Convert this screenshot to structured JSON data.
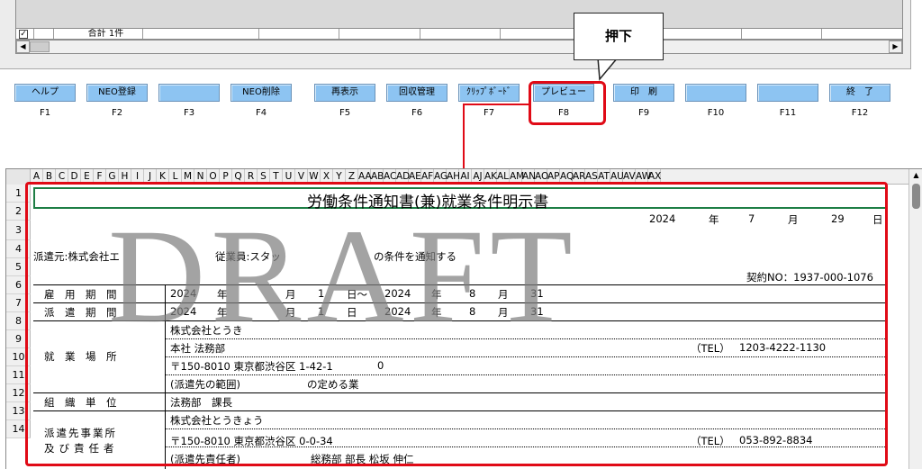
{
  "list": {
    "checkbox_mark": "✓",
    "total_label": "合計 1件",
    "scroll_left": "◀",
    "scroll_right": "▶"
  },
  "function_keys": [
    {
      "label": "ヘルプ",
      "key": "F1"
    },
    {
      "label": "NEO登録",
      "key": "F2"
    },
    {
      "label": "",
      "key": "F3"
    },
    {
      "label": "NEO削除",
      "key": "F4"
    },
    {
      "label": "再表示",
      "key": "F5"
    },
    {
      "label": "回収管理",
      "key": "F6"
    },
    {
      "label": "ｸﾘｯﾌﾟﾎﾞｰﾄﾞ",
      "key": "F7"
    },
    {
      "label": "プレビュー",
      "key": "F8"
    },
    {
      "label": "印　刷",
      "key": "F9"
    },
    {
      "label": "",
      "key": "F10"
    },
    {
      "label": "",
      "key": "F11"
    },
    {
      "label": "終　了",
      "key": "F12"
    }
  ],
  "callout": {
    "text": "押下"
  },
  "colors": {
    "highlight": "#e00a16",
    "button": "#8dc4f2",
    "selection": "#1e7e45"
  },
  "sheet": {
    "column_headers": "A B C D E F G H I J K L M N O P Q R S T U V W X Y Z AA AB AC AD AE AF AG AH AI AJ AK AL AM AN AO AP AQ AR AS AT AU AV AW AX",
    "row_numbers": [
      "1",
      "2",
      "3",
      "4",
      "5",
      "6",
      "7",
      "8",
      "9",
      "10",
      "11",
      "12",
      "13",
      "14"
    ],
    "scroll_up": "▲"
  },
  "document": {
    "title": "労働条件通知書(兼)就業条件明示書",
    "date": {
      "year": "2024",
      "year_unit": "年",
      "month": "7",
      "month_unit": "月",
      "day": "29",
      "day_unit": "日"
    },
    "dispatch_line": "派遣元:株式会社エ",
    "dispatch_line_2": "従業員:スタッ",
    "dispatch_line_3": "の条件を通知する",
    "contract_no": "契約NO：1937-000-1076",
    "rows": {
      "employment_period": {
        "label": "雇　用　期　間",
        "start_year": "2024",
        "year_unit": "年",
        "month_unit": "月",
        "start_day": "1",
        "day_unit": "日～",
        "end_year": "2024",
        "end_year_unit": "年",
        "end_month": "8",
        "end_month_unit": "月",
        "end_day": "31"
      },
      "dispatch_period": {
        "label": "派　遣　期　間",
        "start_year": "2024",
        "year_unit": "年",
        "month_unit": "月",
        "start_day": "1",
        "day_unit": "日",
        "end_year": "2024",
        "end_year_unit": "年",
        "end_month": "8",
        "end_month_unit": "月",
        "end_day": "31"
      },
      "workplace": {
        "label": "就　業　場　所",
        "company": "株式会社とうき",
        "branch": "本社 法務部",
        "tel_label": "（TEL）",
        "tel": "1203-4222-1130",
        "address": "〒150-8010 東京都渋谷区 1-42-1",
        "address_tail": "0",
        "note": "(派遣先の範囲)",
        "note_tail": "の定める業"
      },
      "org_unit": {
        "label": "組　織　単　位",
        "value": "法務部　課長"
      },
      "client": {
        "label_line1": "派遣先事業所",
        "label_line2": "及び責任者",
        "company": "株式会社とうきょう",
        "address": "〒150-8010 東京都渋谷区 0-0-34",
        "tel_label": "（TEL）",
        "tel": "053-892-8834",
        "supervisor_label": "(派遣先責任者)",
        "supervisor": "総務部 部長 松坂 伸仁"
      }
    }
  },
  "watermark": "DRAFT"
}
